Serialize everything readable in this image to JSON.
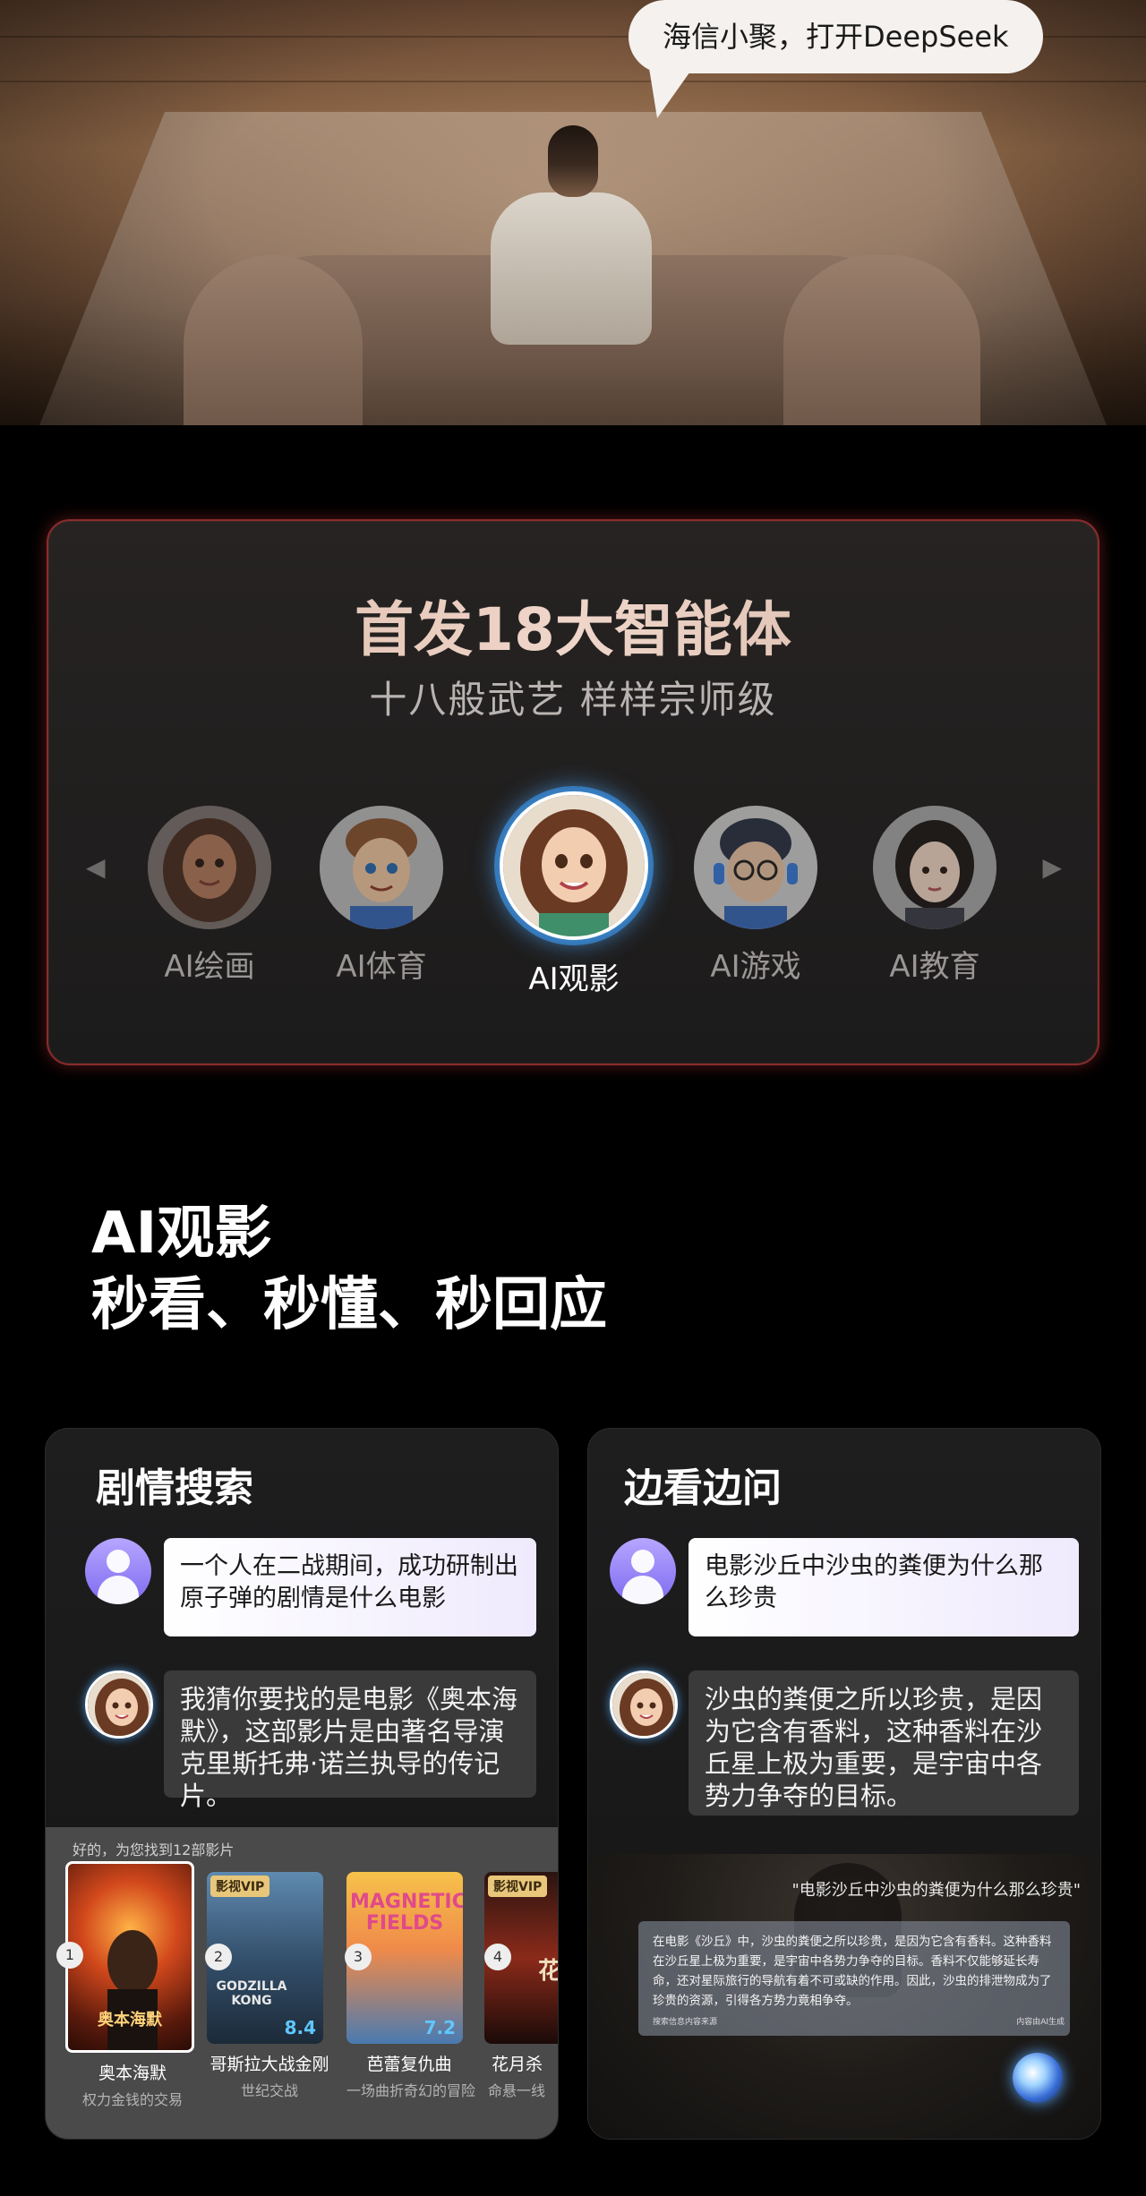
{
  "hero": {
    "bubble_text": "海信小聚，打开DeepSeek"
  },
  "agents": {
    "title": "首发18大智能体",
    "subtitle": "十八般武艺 样样宗师级",
    "prev_arrow": "◀",
    "next_arrow": "▶",
    "items": [
      {
        "label": "AI绘画",
        "active": false
      },
      {
        "label": "AI体育",
        "active": false
      },
      {
        "label": "AI观影",
        "active": true
      },
      {
        "label": "AI游戏",
        "active": false
      },
      {
        "label": "AI教育",
        "active": false
      }
    ]
  },
  "section": {
    "line1": "AI观影",
    "line2": "秒看、秒懂、秒回应"
  },
  "card_left": {
    "title": "剧情搜索",
    "question": "一个人在二战期间，成功研制出原子弹的剧情是什么电影",
    "answer": "我猜你要找的是电影《奥本海默》，这部影片是由著名导演克里斯托弗·诺兰执导的传记片。",
    "results_hint": "好的，为您找到12部影片",
    "movies": [
      {
        "rank": "1",
        "name": "奥本海默",
        "desc": "权力金钱的交易",
        "vip": "",
        "score": "",
        "poster_text": "奥本海默"
      },
      {
        "rank": "2",
        "name": "哥斯拉大战金刚",
        "desc": "世纪交战",
        "vip": "影视VIP",
        "score": "8.4",
        "poster_text": "GODZILLA KONG"
      },
      {
        "rank": "3",
        "name": "芭蕾复仇曲",
        "desc": "一场曲折奇幻的冒险",
        "vip": "",
        "score": "7.2",
        "poster_text": "MAGNETIC FIELDS"
      },
      {
        "rank": "4",
        "name": "花月杀",
        "desc": "命悬一线",
        "vip": "影视VIP",
        "score": "",
        "poster_text": "花"
      }
    ]
  },
  "card_right": {
    "title": "边看边问",
    "question": "电影沙丘中沙虫的粪便为什么那么珍贵",
    "answer": "沙虫的粪便之所以珍贵，是因为它含有香料，这种香料在沙丘星上极为重要，是宇宙中各势力争夺的目标。",
    "video_quote": "\"电影沙丘中沙虫的粪便为什么那么珍贵\"",
    "video_answer": "在电影《沙丘》中，沙虫的粪便之所以珍贵，是因为它含有香料。这种香料在沙丘星上极为重要，是宇宙中各势力争夺的目标。香料不仅能够延长寿命，还对星际旅行的导航有着不可或缺的作用。因此，沙虫的排泄物成为了珍贵的资源，引得各方势力竟相争夺。",
    "video_source": "搜索信息内容来源",
    "video_tag": "内容由AI生成"
  },
  "colors": {
    "panel_border": "#8a2c2c",
    "active_glow": "#50aaff",
    "user_bubble": "#efeafd"
  }
}
